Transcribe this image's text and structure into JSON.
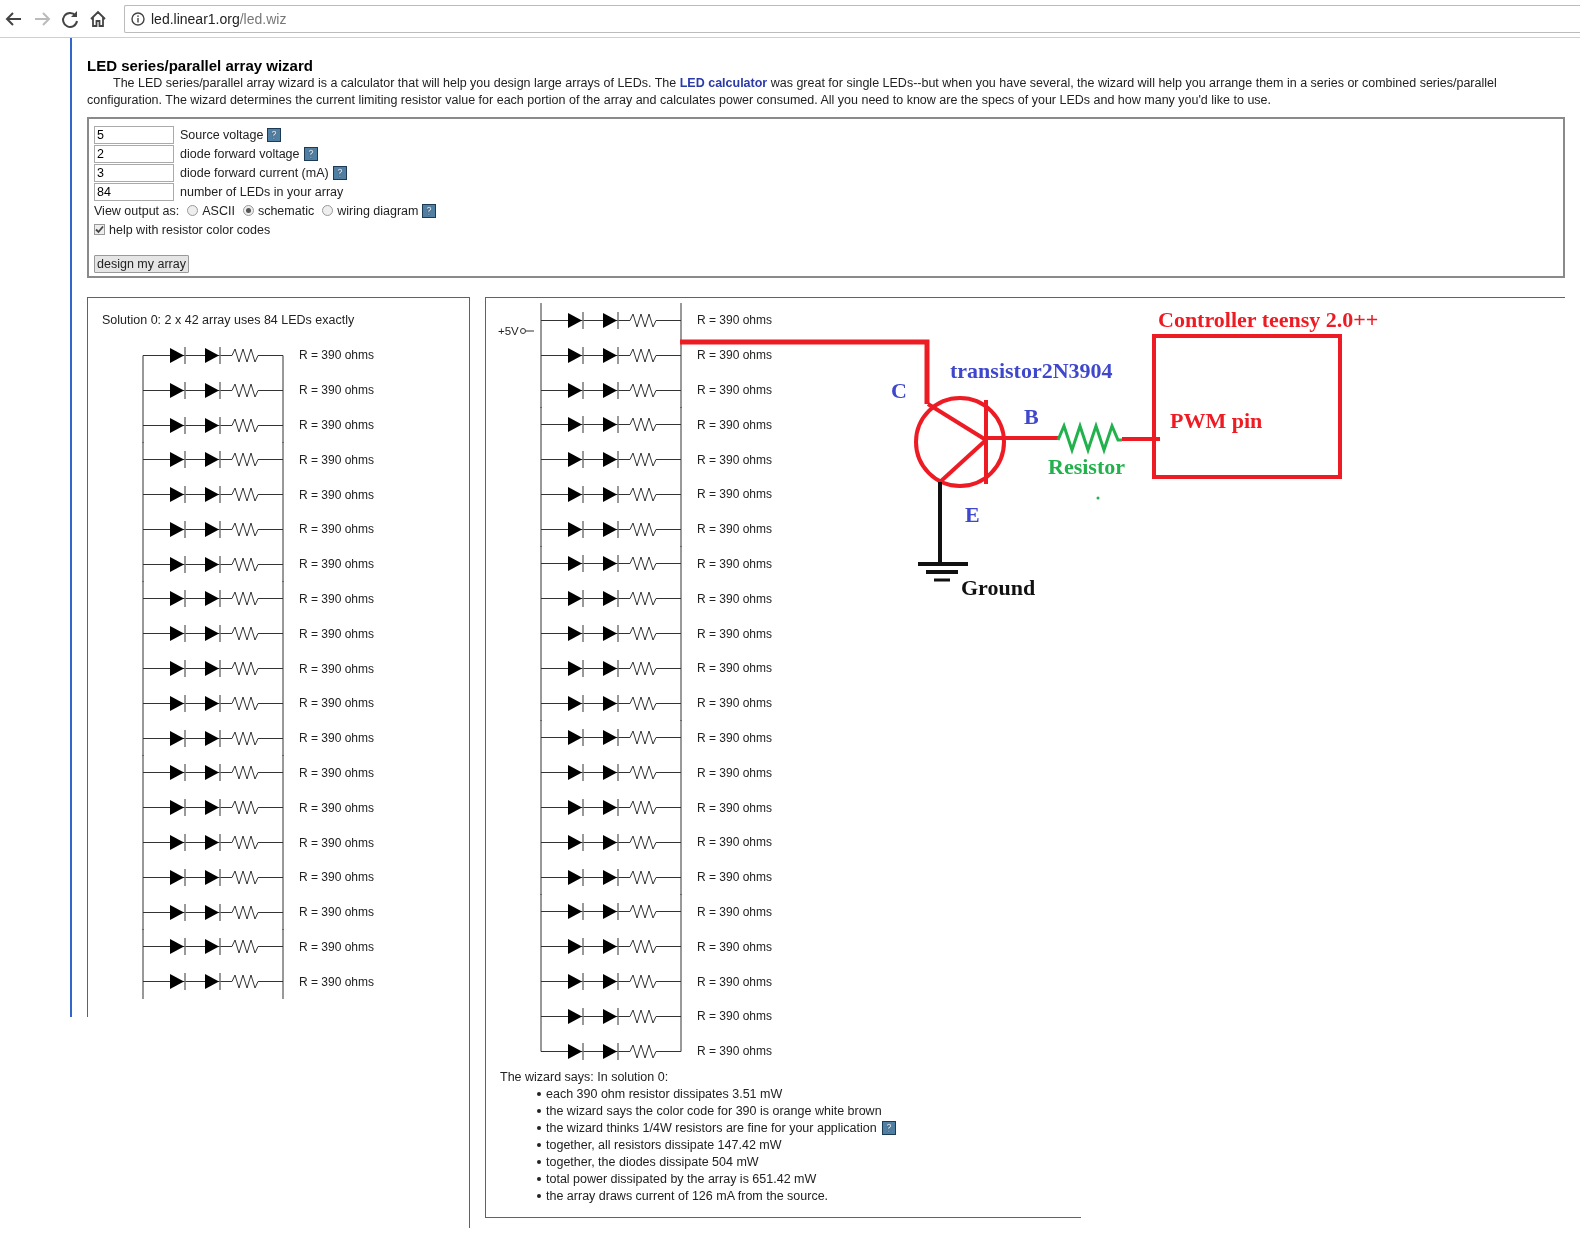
{
  "browser": {
    "url_host": "led.linear1.org",
    "url_path": "/led.wiz"
  },
  "page": {
    "title": "LED series/parallel array wizard",
    "intro_start": "The LED series/parallel array wizard is a calculator that will help you design large arrays of LEDs. The ",
    "intro_link": "LED calculator",
    "intro_end": " was great for single LEDs--but when you have several, the wizard will help you arrange them in a series or combined series/parallel configuration. The wizard determines the current limiting resistor value for each portion of the array and calculates power consumed. All you need to know are the specs of your LEDs and how many you'd like to use."
  },
  "form": {
    "fields": [
      {
        "value": "5",
        "label": "Source voltage",
        "help": true
      },
      {
        "value": "2",
        "label": "diode forward voltage",
        "help": true
      },
      {
        "value": "3",
        "label": "diode forward current (mA)",
        "help": true
      },
      {
        "value": "84",
        "label": "number of LEDs in your array",
        "help": false
      }
    ],
    "view_output": {
      "label": "View output as:",
      "help": true,
      "options": [
        {
          "label": "ASCII",
          "selected": false
        },
        {
          "label": "schematic",
          "selected": true
        },
        {
          "label": "wiring diagram",
          "selected": false
        }
      ]
    },
    "color_codes": {
      "label": "help with resistor color codes",
      "checked": true
    },
    "submit": "design my array"
  },
  "solution_left": {
    "heading": "Solution 0: 2 x 42 array uses 84 LEDs exactly",
    "rows": [
      "R = 390 ohms",
      "R = 390 ohms",
      "R = 390 ohms",
      "R = 390 ohms",
      "R = 390 ohms",
      "R = 390 ohms",
      "R = 390 ohms",
      "R = 390 ohms",
      "R = 390 ohms",
      "R = 390 ohms",
      "R = 390 ohms",
      "R = 390 ohms",
      "R = 390 ohms",
      "R = 390 ohms",
      "R = 390 ohms",
      "R = 390 ohms",
      "R = 390 ohms",
      "R = 390 ohms",
      "R = 390 ohms"
    ]
  },
  "solution_right": {
    "source_label": "+5V",
    "rows": [
      "R = 390 ohms",
      "R = 390 ohms",
      "R = 390 ohms",
      "R = 390 ohms",
      "R = 390 ohms",
      "R = 390 ohms",
      "R = 390 ohms",
      "R = 390 ohms",
      "R = 390 ohms",
      "R = 390 ohms",
      "R = 390 ohms",
      "R = 390 ohms",
      "R = 390 ohms",
      "R = 390 ohms",
      "R = 390 ohms",
      "R = 390 ohms",
      "R = 390 ohms",
      "R = 390 ohms",
      "R = 390 ohms",
      "R = 390 ohms",
      "R = 390 ohms",
      "R = 390 ohms"
    ],
    "summary": {
      "heading": "The wizard says: In solution 0:",
      "items": [
        {
          "text": "each 390 ohm resistor dissipates 3.51 mW",
          "help": false
        },
        {
          "text": "the wizard says the color code for 390 is orange white brown",
          "help": false
        },
        {
          "text": "the wizard thinks 1/4W resistors are fine for your application",
          "help": true
        },
        {
          "text": "together, all resistors dissipate 147.42 mW",
          "help": false
        },
        {
          "text": "together, the diodes dissipate 504 mW",
          "help": false
        },
        {
          "text": "total power dissipated by the array is 651.42 mW",
          "help": false
        },
        {
          "text": "the array draws current of 126 mA from the source.",
          "help": false
        }
      ]
    }
  },
  "annotations": {
    "controller_label": "Controller teensy 2.0++",
    "pin_label": "PWM pin",
    "transistor_label": "transistor2N3904",
    "collector": "C",
    "base": "B",
    "emitter": "E",
    "resistor_label": "Resistor",
    "ground_label": "Ground"
  }
}
